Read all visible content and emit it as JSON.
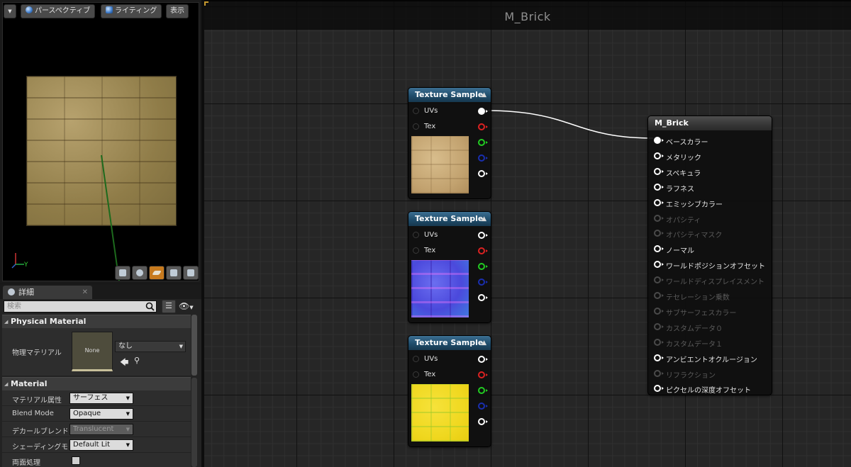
{
  "viewport": {
    "perspective_label": "パースペクティブ",
    "lighting_label": "ライティング",
    "show_label": "表示",
    "axis_label": "Y"
  },
  "details": {
    "tab_label": "詳細",
    "search_placeholder": "検索",
    "sections": {
      "physical_material": {
        "title": "Physical Material",
        "label": "物理マテリアル",
        "thumbnail_text": "None",
        "dropdown_value": "なし"
      },
      "material": {
        "title": "Material",
        "rows": [
          {
            "label": "マテリアル属性",
            "value": "サーフェス",
            "disabled": false
          },
          {
            "label": "Blend Mode",
            "value": "Opaque",
            "disabled": false
          },
          {
            "label": "デカールブレンドモ",
            "value": "Translucent",
            "disabled": true
          },
          {
            "label": "シェーディングモデル",
            "value": "Default Lit",
            "disabled": false
          },
          {
            "label": "両面処理",
            "checkbox": true
          }
        ]
      }
    }
  },
  "graph": {
    "title": "M_Brick",
    "texture_nodes": [
      {
        "title": "Texture Sample",
        "inputs": [
          "UVs",
          "Tex"
        ],
        "texture": "brick-diffuse"
      },
      {
        "title": "Texture Sample",
        "inputs": [
          "UVs",
          "Tex"
        ],
        "texture": "brick-normal"
      },
      {
        "title": "Texture Sample",
        "inputs": [
          "UVs",
          "Tex"
        ],
        "texture": "brick-mask"
      }
    ],
    "result_node": {
      "title": "M_Brick",
      "pins": [
        {
          "label": "ベースカラー",
          "enabled": true,
          "connected": true
        },
        {
          "label": "メタリック",
          "enabled": true
        },
        {
          "label": "スペキュラ",
          "enabled": true
        },
        {
          "label": "ラフネス",
          "enabled": true
        },
        {
          "label": "エミッシブカラー",
          "enabled": true
        },
        {
          "label": "オパシティ",
          "enabled": false
        },
        {
          "label": "オパシティマスク",
          "enabled": false
        },
        {
          "label": "ノーマル",
          "enabled": true
        },
        {
          "label": "ワールドポジションオフセット",
          "enabled": true
        },
        {
          "label": "ワールドディスプレイスメント",
          "enabled": false
        },
        {
          "label": "テセレーション乗数",
          "enabled": false
        },
        {
          "label": "サブサーフェスカラー",
          "enabled": false
        },
        {
          "label": "カスタムデータ０",
          "enabled": false
        },
        {
          "label": "カスタムデータ１",
          "enabled": false
        },
        {
          "label": "アンビエントオクルージョン",
          "enabled": true
        },
        {
          "label": "リフラクション",
          "enabled": false
        },
        {
          "label": "ピクセルの深度オフセット",
          "enabled": true
        }
      ]
    },
    "pin_colors": {
      "rgb": "#ffffff",
      "r": "#dd2222",
      "g": "#22cc22",
      "b": "#1a2fb0",
      "a": "#ffffff"
    }
  }
}
